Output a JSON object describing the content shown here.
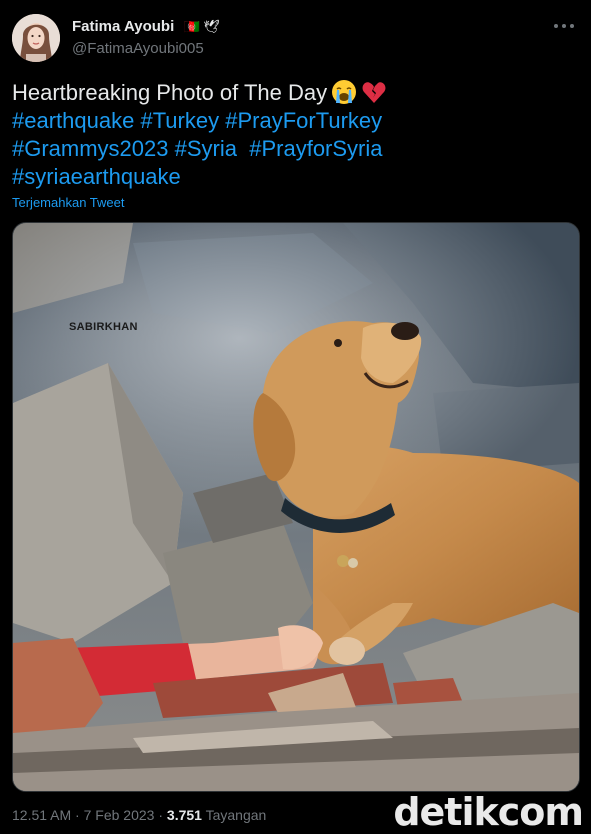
{
  "user": {
    "display_name": "Fatima Ayoubi",
    "name_emojis": "🇦🇫 🕊",
    "handle": "@FatimaAyoubi005",
    "avatar_icon": "profile-photo"
  },
  "more_icon": "more-dots-icon",
  "tweet": {
    "line1_text": "Heartbreaking Photo of The Day",
    "line1_emoji_icons": [
      "loudly-crying-face-icon",
      "broken-heart-icon"
    ],
    "hashtags": [
      [
        "#earthquake",
        "#Turkey",
        "#PrayForTurkey"
      ],
      [
        "#Grammys2023",
        "#Syria",
        "#PrayforSyria"
      ],
      [
        "#syriaearthquake"
      ]
    ]
  },
  "translate_label": "Terjemahkan Tweet",
  "media": {
    "watermark": "SABIRKHAN",
    "description_icon": "dog-on-rubble-photo"
  },
  "meta": {
    "time": "12.51 AM",
    "separator": "·",
    "date": "7 Feb 2023",
    "views": "3.751",
    "views_label": "Tayangan"
  },
  "brand": {
    "text": "detikcom"
  },
  "colors": {
    "background": "#000000",
    "text": "#e7e9ea",
    "secondary": "#71767b",
    "link": "#1d9bf0"
  }
}
